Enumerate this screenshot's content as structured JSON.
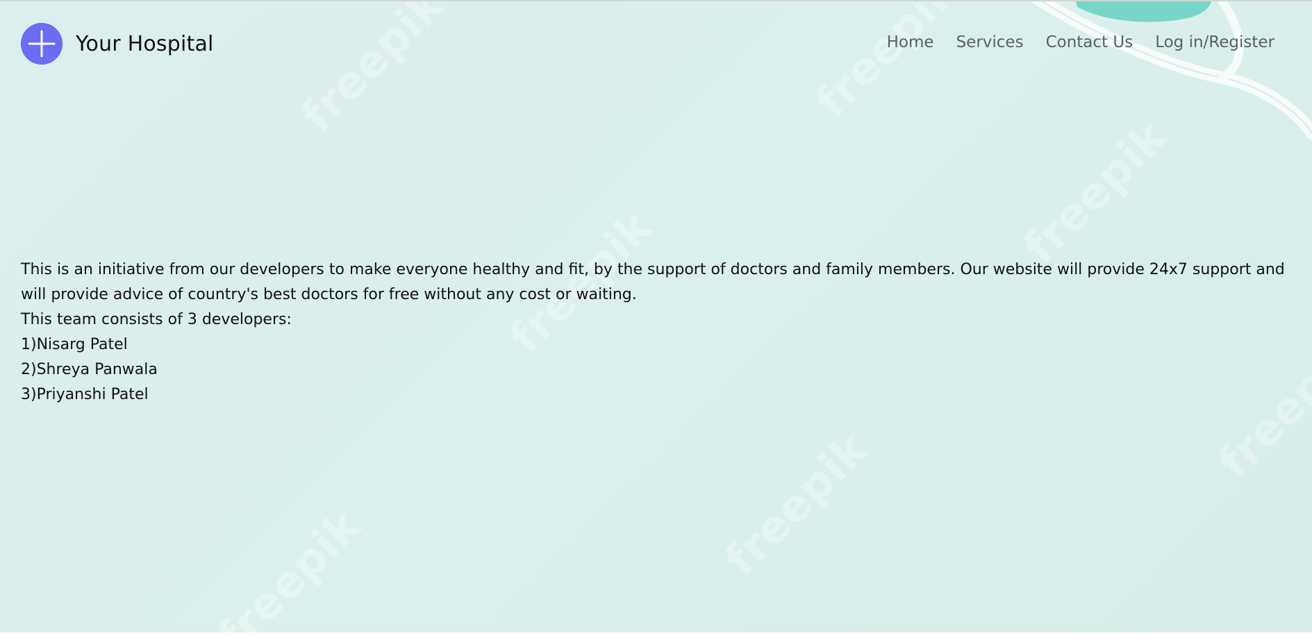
{
  "header": {
    "logo_icon": "plus-icon",
    "brand_name": "Your Hospital",
    "nav": [
      {
        "label": "Home"
      },
      {
        "label": "Services"
      },
      {
        "label": "Contact Us"
      },
      {
        "label": "Log in/Register"
      }
    ]
  },
  "main": {
    "intro": "This is an initiative from our developers to make everyone healthy and fit, by the support of doctors and family members. Our website will provide 24x7 support and will provide advice of country's best doctors for free without any cost or waiting.",
    "team_heading": "This team consists of 3 developers:",
    "developers": [
      "1)Nisarg Patel",
      "2)Shreya Panwala",
      "3)Priyanshi Patel"
    ]
  },
  "background": {
    "watermark_text": "freepik"
  },
  "colors": {
    "background": "#dbeeec",
    "logo": "#6b6cf2",
    "nav_text": "#5c6166",
    "body_text": "#111111",
    "accent_teal": "#78d6c8"
  }
}
